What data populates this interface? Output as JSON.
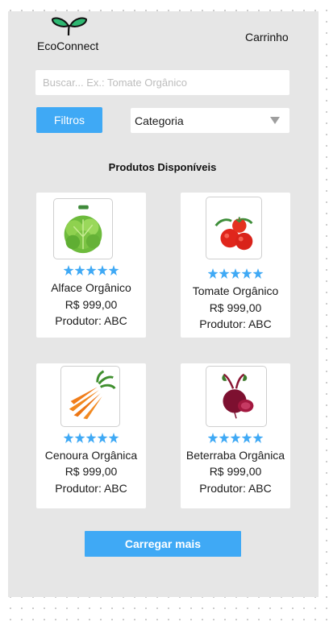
{
  "header": {
    "brand": "EcoConnect",
    "cart_label": "Carrinho",
    "logo_icon": "sprout-icon"
  },
  "search": {
    "placeholder": "Buscar... Ex.: Tomate Orgânico",
    "value": ""
  },
  "filters": {
    "filter_button_label": "Filtros",
    "category_select": {
      "selected": "Categoria",
      "icon": "caret-down-icon"
    }
  },
  "section_title": "Produtos Disponíveis",
  "products": [
    {
      "name": "Alface Orgânico",
      "price": "R$ 999,00",
      "producer": "Produtor: ABC",
      "rating": 5,
      "rating_max": 5,
      "image_icon": "lettuce-image"
    },
    {
      "name": "Tomate Orgânico",
      "price": "R$ 999,00",
      "producer": "Produtor: ABC",
      "rating": 5,
      "rating_max": 5,
      "image_icon": "tomato-image"
    },
    {
      "name": "Cenoura Orgânica",
      "price": "R$ 999,00",
      "producer": "Produtor: ABC",
      "rating": 5,
      "rating_max": 5,
      "image_icon": "carrot-image"
    },
    {
      "name": "Beterraba Orgânica",
      "price": "R$ 999,00",
      "producer": "Produtor: ABC",
      "rating": 5,
      "rating_max": 5,
      "image_icon": "beet-image"
    }
  ],
  "load_more_label": "Carregar mais",
  "colors": {
    "accent": "#3fa9f5",
    "frame_background": "#e6e6e6",
    "card_background": "#ffffff"
  }
}
